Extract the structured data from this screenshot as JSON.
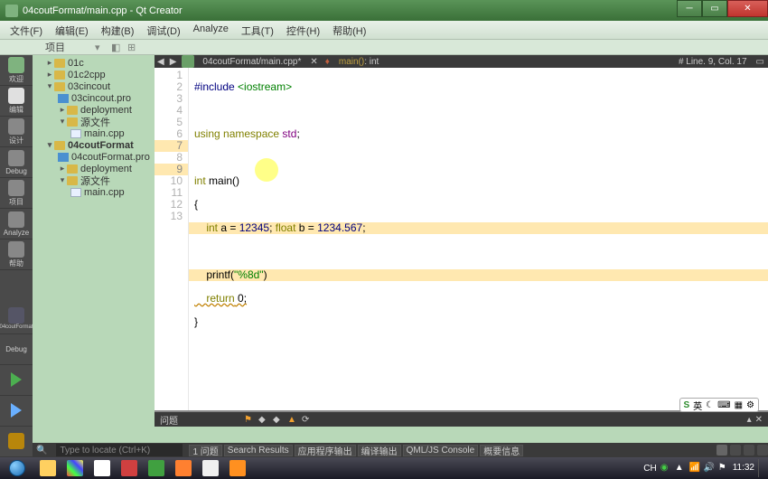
{
  "window": {
    "title": "04coutFormat/main.cpp - Qt Creator"
  },
  "menu": {
    "file": "文件(F)",
    "edit": "编辑(E)",
    "build": "构建(B)",
    "debug": "调试(D)",
    "analyze": "Analyze",
    "tools": "工具(T)",
    "widgets": "控件(H)",
    "help": "帮助(H)"
  },
  "projectPane": {
    "label": "项目"
  },
  "tree": {
    "p1": "01c",
    "p2": "01c2cpp",
    "p3": "03cincout",
    "p3_pro": "03cincout.pro",
    "p3_dep": "deployment",
    "p3_src": "源文件",
    "p3_main": "main.cpp",
    "p4": "04coutFormat",
    "p4_pro": "04coutFormat.pro",
    "p4_dep": "deployment",
    "p4_src": "源文件",
    "p4_main": "main.cpp"
  },
  "editorTab": {
    "file": "04coutFormat/main.cpp*",
    "crumb_fn": "main()",
    "crumb_ret": ": int",
    "position": "# Line. 9, Col. 17"
  },
  "iconbar": {
    "welcome": "欢迎",
    "edit": "编辑",
    "design": "设计",
    "debug": "Debug",
    "projects": "项目",
    "analyze": "Analyze",
    "help": "帮助",
    "target": "04coutFormat",
    "debugLabel": "Debug"
  },
  "code": {
    "l1_a": "#include",
    "l1_b": "<iostream>",
    "l3_a": "using",
    "l3_b": "namespace",
    "l3_c": "std",
    "l3_d": ";",
    "l5_a": "int",
    "l5_b": "main",
    "l5_c": "()",
    "l6": "{",
    "l7_a": "    int",
    "l7_b": " a = ",
    "l7_c": "12345",
    "l7_d": "; ",
    "l7_e": "float",
    "l7_f": " b = ",
    "l7_g": "1234.567",
    "l7_h": ";",
    "l9_a": "    printf(",
    "l9_b": "\"%8d\"",
    "l9_c": ")",
    "l10_a": "    return",
    "l10_b": " 0;",
    "l11": "}",
    "lines": {
      "1": "1",
      "2": "2",
      "3": "3",
      "4": "4",
      "5": "5",
      "6": "6",
      "7": "7",
      "8": "8",
      "9": "9",
      "10": "10",
      "11": "11",
      "12": "12",
      "13": "13"
    }
  },
  "issues": {
    "label": "问题"
  },
  "outtabs": {
    "locate_ph": "Type to locate (Ctrl+K)",
    "t1": "1 问题",
    "t2": "Search Results",
    "t3": "应用程序输出",
    "t4": "编译输出",
    "t5": "QML/JS Console",
    "t6": "概要信息"
  },
  "ime": {
    "lang": "英"
  },
  "clock": {
    "time": "11:32",
    "date": ""
  }
}
